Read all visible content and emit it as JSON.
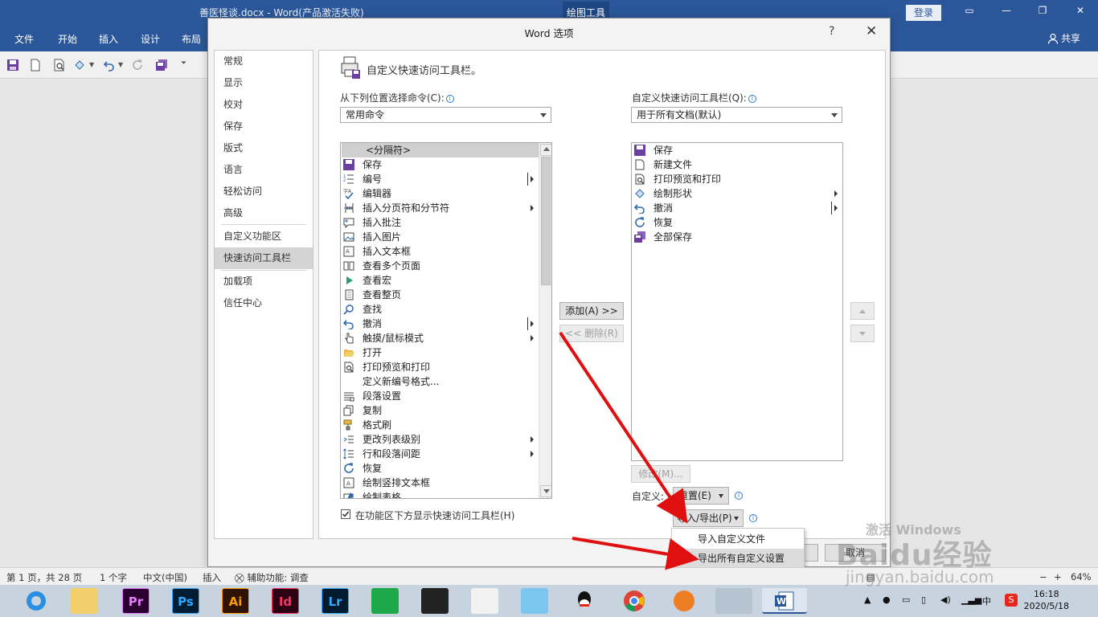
{
  "window": {
    "doc_title": "善医怪谈.docx  -  Word(产品激活失败)",
    "context_tab": "绘图工具",
    "login": "登录",
    "share": "共享"
  },
  "ribbon": {
    "tabs": [
      "文件",
      "开始",
      "插入",
      "设计",
      "布局"
    ]
  },
  "dialog": {
    "title": "Word 选项",
    "help": "?",
    "close": "✕",
    "nav": [
      {
        "label": "常规"
      },
      {
        "label": "显示"
      },
      {
        "label": "校对"
      },
      {
        "label": "保存"
      },
      {
        "label": "版式"
      },
      {
        "label": "语言"
      },
      {
        "label": "轻松访问"
      },
      {
        "label": "高级"
      },
      {
        "label": "自定义功能区"
      },
      {
        "label": "快速访问工具栏"
      },
      {
        "label": "加载项"
      },
      {
        "label": "信任中心"
      }
    ],
    "selected_nav": "快速访问工具栏",
    "heading": "自定义快速访问工具栏。",
    "choose_commands_label": "从下列位置选择命令(C):",
    "choose_commands_value": "常用命令",
    "customize_label": "自定义快速访问工具栏(Q):",
    "customize_value": "用于所有文档(默认)",
    "commands": [
      "<分隔符>",
      "保存",
      "编号",
      "编辑器",
      "插入分页符和分节符",
      "插入批注",
      "插入图片",
      "插入文本框",
      "查看多个页面",
      "查看宏",
      "查看整页",
      "查找",
      "撤消",
      "触摸/鼠标模式",
      "打开",
      "打印预览和打印",
      "定义新编号格式...",
      "段落设置",
      "复制",
      "格式刷",
      "更改列表级别",
      "行和段落间距",
      "恢复",
      "绘制竖排文本框",
      "绘制表格"
    ],
    "toolbar_items": [
      "保存",
      "新建文件",
      "打印预览和打印",
      "绘制形状",
      "撤消",
      "恢复",
      "全部保存"
    ],
    "add_button": "添加(A) >>",
    "remove_button": "<< 删除(R)",
    "modify_button": "修改(M)...",
    "customize_text": "自定义:",
    "reset_button": "重置(E)",
    "import_export_button": "导入/导出(P)",
    "show_below_ribbon": "在功能区下方显示快速访问工具栏(H)",
    "show_below_checked": true,
    "menu_items": [
      "导入自定义文件",
      "导出所有自定义设置"
    ],
    "ok_cancel_fragment": "取消"
  },
  "statusbar": {
    "page": "第 1 页，共 28 页",
    "words": "1 个字",
    "language": "中文(中国)",
    "mode": "插入",
    "accessibility": "辅助功能: 调查",
    "zoom": "64%"
  },
  "taskbar": {
    "time": "16:18",
    "date": "2020/5/18",
    "ime": "中",
    "apps": [
      "Pr",
      "Ps",
      "Ai",
      "Id",
      "Lr"
    ]
  },
  "watermark": {
    "brand": "Baidu经验",
    "url": "jingyan.baidu.com",
    "activate": "激活 Windows"
  },
  "colors": {
    "word_blue": "#2b579a",
    "annotation_red": "#e01010"
  }
}
